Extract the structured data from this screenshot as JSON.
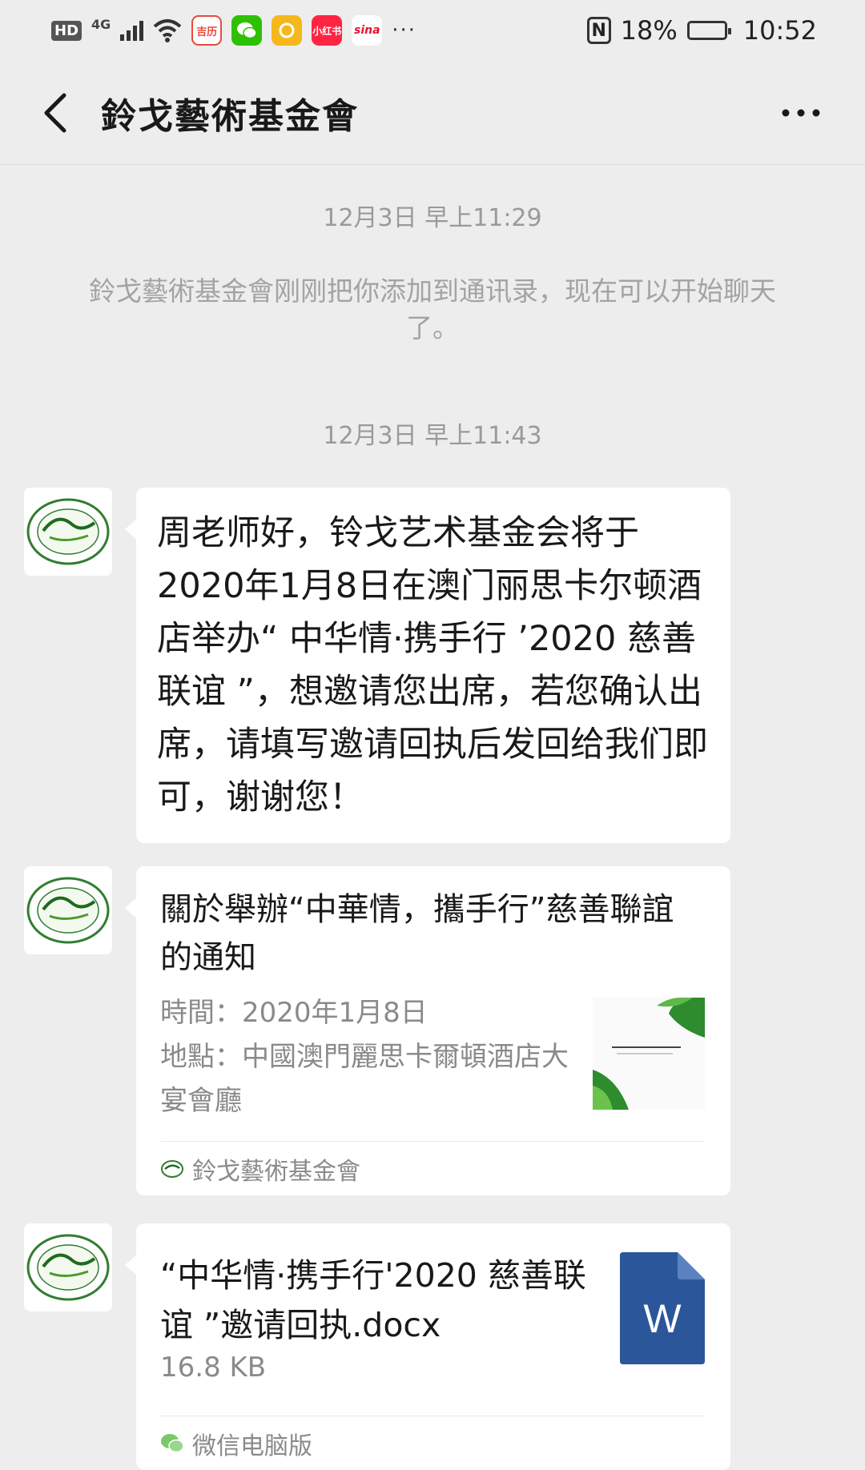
{
  "status_bar": {
    "hd": "HD",
    "network": "4G",
    "apps": [
      {
        "icon": "calendar-app-icon",
        "label": "吉历",
        "color": "#e84a3c"
      },
      {
        "icon": "wechat-app-icon",
        "label": "",
        "color": "#2dc100"
      },
      {
        "icon": "yellow-app-icon",
        "label": "",
        "color": "#f5b81c"
      },
      {
        "icon": "xiaohongshu-app-icon",
        "label": "小红书",
        "color": "#ff2442"
      },
      {
        "icon": "sina-app-icon",
        "label": "sina",
        "color": "#e6162d"
      }
    ],
    "more": "···",
    "nfc": "N",
    "battery_percent": "18%",
    "battery_level": 0.18,
    "time": "10:52"
  },
  "header": {
    "title": "鈴戈藝術基金會",
    "more_label": "···"
  },
  "chat": {
    "timestamp_1": "12月3日 早上11:29",
    "system_message": "鈴戈藝術基金會刚刚把你添加到通讯录，现在可以开始聊天了。",
    "timestamp_2": "12月3日 早上11:43",
    "text_message": "周老师好，铃戈艺术基金会将于2020年1月8日在澳门丽思卡尔顿酒店举办“ 中华情·携手行 ’2020 慈善联谊 ”，想邀请您出席，若您确认出席，请填写邀请回执后发回给我们即可，谢谢您！",
    "link_card": {
      "title": "關於舉辦“中華情，攜手行”慈善聯誼的通知",
      "desc_line_1": "時間：2020年1月8日",
      "desc_line_2": "地點：中國澳門麗思卡爾頓酒店大宴會廳",
      "source": "鈴戈藝術基金會"
    },
    "file_card": {
      "name": "“中华情·携手行'2020 慈善联谊 ”邀请回执.docx",
      "size": "16.8 KB",
      "icon_letter": "W",
      "source": "微信电脑版"
    }
  },
  "colors": {
    "background": "#ededed",
    "bubble": "#ffffff",
    "word_blue": "#2b579a",
    "muted_text": "#9a9a9a"
  }
}
